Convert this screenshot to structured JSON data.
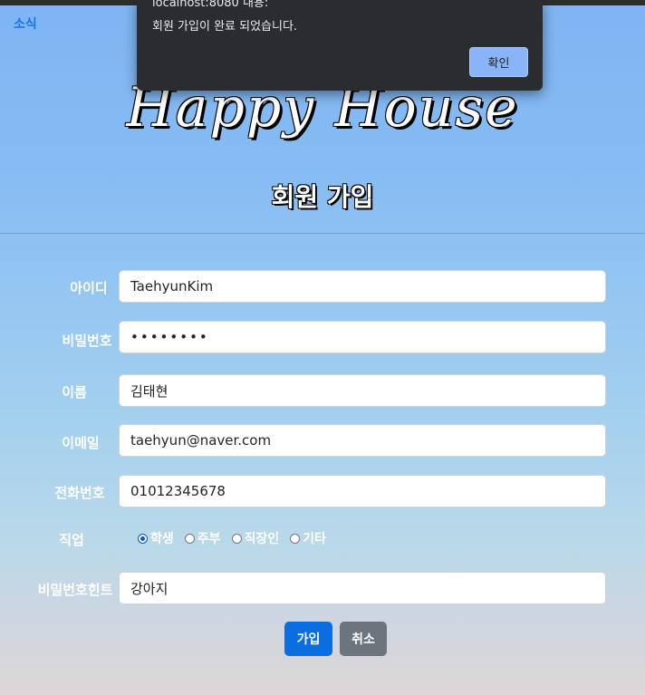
{
  "nav": {
    "news_link": "소식"
  },
  "hero": {
    "title": "Happy House"
  },
  "page": {
    "title": "회원 가입"
  },
  "form": {
    "id": {
      "label": "아이디",
      "value": "TaehyunKim"
    },
    "password": {
      "label": "비밀번호",
      "value": "••••••••"
    },
    "name": {
      "label": "이름",
      "value": "김태현"
    },
    "email": {
      "label": "이메일",
      "value": "taehyun@naver.com"
    },
    "phone": {
      "label": "전화번호",
      "value": "01012345678"
    },
    "job": {
      "label": "직업",
      "options": [
        "학생",
        "주부",
        "직장인",
        "기타"
      ],
      "selected": "학생"
    },
    "hint": {
      "label": "비밀번호힌트",
      "value": "강아지"
    }
  },
  "buttons": {
    "submit": "가입",
    "cancel": "취소"
  },
  "dialog": {
    "origin": "localhost:8080 내용:",
    "message": "회원 가입이 완료 되었습니다.",
    "ok": "확인"
  }
}
